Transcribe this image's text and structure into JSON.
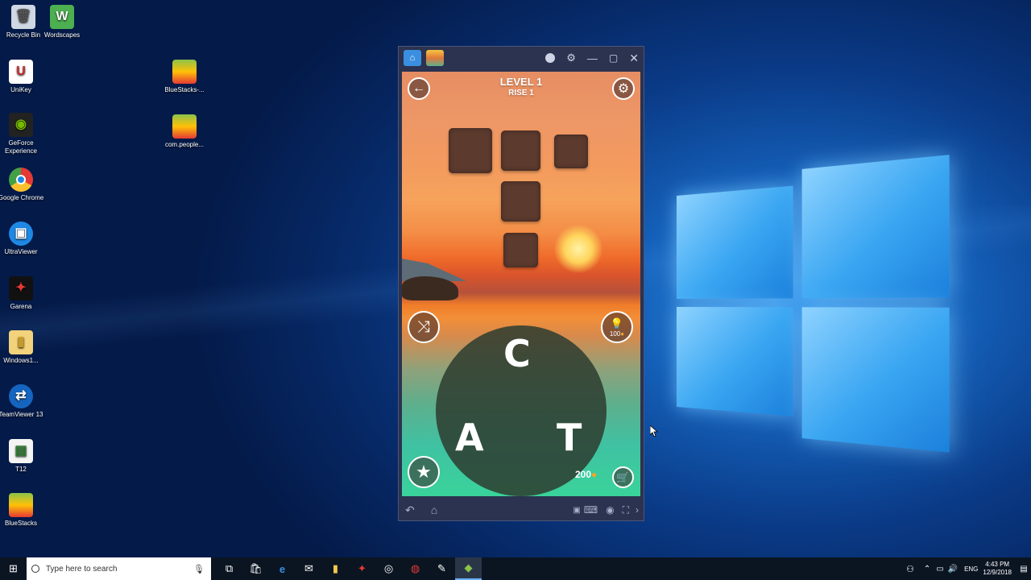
{
  "desktop": {
    "icons": [
      {
        "label": "Recycle Bin",
        "glyph": "🗑",
        "color": "#cfd8e3",
        "icon": "recycle-bin-icon"
      },
      {
        "label": "Wordscapes",
        "glyph": "W",
        "color": "#4caf50",
        "icon": "wordscapes-icon"
      },
      {
        "label": "UniKey",
        "glyph": "U",
        "color": "#ffffff",
        "icon": "unikey-icon"
      },
      {
        "label": "BlueStacks-...",
        "glyph": "◆",
        "color": "#8bc34a",
        "icon": "bluestacks-icon"
      },
      {
        "label": "GeForce Experience",
        "glyph": "◉",
        "color": "#222222",
        "icon": "geforce-icon"
      },
      {
        "label": "com.people...",
        "glyph": "◆",
        "color": "#8bc34a",
        "icon": "bluestacks-apk-icon"
      },
      {
        "label": "Google Chrome",
        "glyph": "◍",
        "color": "#e53935",
        "icon": "chrome-icon"
      },
      {
        "label": "UltraViewer",
        "glyph": "▣",
        "color": "#1e88e5",
        "icon": "ultraviewer-icon"
      },
      {
        "label": "Garena",
        "glyph": "✦",
        "color": "#b71c1c",
        "icon": "garena-icon"
      },
      {
        "label": "Windows1...",
        "glyph": "▮",
        "color": "#f2d27a",
        "icon": "folder-icon"
      },
      {
        "label": "TeamViewer 13",
        "glyph": "⇄",
        "color": "#1565c0",
        "icon": "teamviewer-icon"
      },
      {
        "label": "T12",
        "glyph": "▤",
        "color": "#2e7d32",
        "icon": "spreadsheet-icon"
      },
      {
        "label": "BlueStacks",
        "glyph": "◆",
        "color": "#8bc34a",
        "icon": "bluestacks-icon"
      }
    ]
  },
  "taskbar": {
    "search_placeholder": "Type here to search",
    "tray_lang": "ENG",
    "time": "4:43 PM",
    "date": "12/9/2018"
  },
  "emulator": {
    "tabs": [
      "home-tab",
      "wordscapes-tab"
    ]
  },
  "game": {
    "level_title": "LEVEL 1",
    "level_subtitle": "RISE 1",
    "hint_cost": "100",
    "coins": "200",
    "letters": [
      "C",
      "A",
      "T"
    ]
  },
  "colors": {
    "accent": "#4aa3ff",
    "tile": "#5c3a2e",
    "coin": "#f5a623"
  }
}
